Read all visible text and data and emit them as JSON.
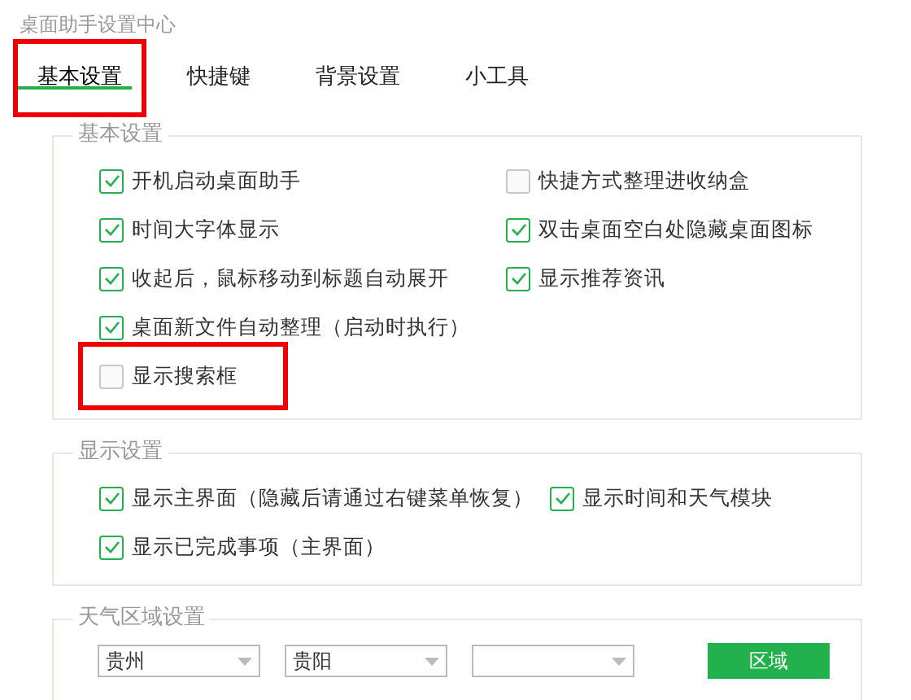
{
  "window": {
    "title": "桌面助手设置中心"
  },
  "tabs": [
    {
      "label": "基本设置",
      "selected": true,
      "highlighted": true
    },
    {
      "label": "快捷键",
      "selected": false,
      "highlighted": false
    },
    {
      "label": "背景设置",
      "selected": false,
      "highlighted": false
    },
    {
      "label": "小工具",
      "selected": false,
      "highlighted": false
    }
  ],
  "groups": [
    {
      "legend": "基本设置",
      "rows": [
        [
          {
            "label": "开机启动桌面助手",
            "checked": true,
            "highlighted": false
          },
          {
            "label": "快捷方式整理进收纳盒",
            "checked": false,
            "highlighted": false
          }
        ],
        [
          {
            "label": "时间大字体显示",
            "checked": true,
            "highlighted": false
          },
          {
            "label": "双击桌面空白处隐藏桌面图标",
            "checked": true,
            "highlighted": false
          }
        ],
        [
          {
            "label": "收起后，鼠标移动到标题自动展开",
            "checked": true,
            "highlighted": false
          },
          {
            "label": "显示推荐资讯",
            "checked": true,
            "highlighted": false
          }
        ],
        [
          {
            "label": "桌面新文件自动整理（启动时执行）",
            "checked": true,
            "highlighted": false
          }
        ],
        [
          {
            "label": "显示搜索框",
            "checked": false,
            "highlighted": true
          }
        ]
      ]
    },
    {
      "legend": "显示设置",
      "rows": [
        [
          {
            "label": "显示主界面（隐藏后请通过右键菜单恢复）",
            "checked": true,
            "highlighted": false
          },
          {
            "label": "显示时间和天气模块",
            "checked": true,
            "highlighted": false
          }
        ],
        [
          {
            "label": "显示已完成事项（主界面）",
            "checked": true,
            "highlighted": false
          }
        ]
      ]
    }
  ],
  "weather": {
    "legend": "天气区域设置",
    "selects": [
      {
        "value": "贵州"
      },
      {
        "value": "贵阳"
      }
    ],
    "blank_select": true,
    "button": "区域"
  }
}
